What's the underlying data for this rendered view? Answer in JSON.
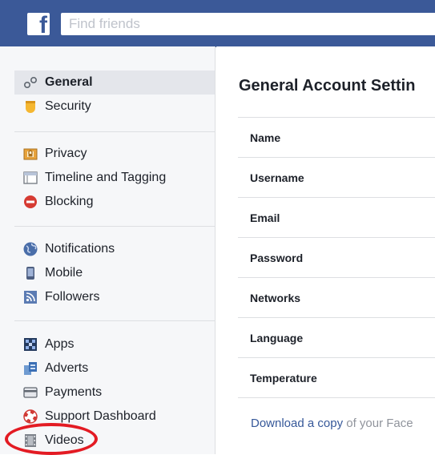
{
  "topbar": {
    "logo_letter": "f",
    "search_placeholder": "Find friends"
  },
  "sidebar": {
    "sections": [
      [
        {
          "label": "General",
          "icon": "gears-icon",
          "active": true
        },
        {
          "label": "Security",
          "icon": "badge-icon"
        }
      ],
      [
        {
          "label": "Privacy",
          "icon": "lock-icon"
        },
        {
          "label": "Timeline and Tagging",
          "icon": "timeline-icon"
        },
        {
          "label": "Blocking",
          "icon": "blocking-icon"
        }
      ],
      [
        {
          "label": "Notifications",
          "icon": "globe-icon"
        },
        {
          "label": "Mobile",
          "icon": "mobile-icon"
        },
        {
          "label": "Followers",
          "icon": "rss-icon"
        }
      ],
      [
        {
          "label": "Apps",
          "icon": "apps-icon"
        },
        {
          "label": "Adverts",
          "icon": "adverts-icon"
        },
        {
          "label": "Payments",
          "icon": "credit-card-icon"
        },
        {
          "label": "Support Dashboard",
          "icon": "lifebuoy-icon"
        },
        {
          "label": "Videos",
          "icon": "film-icon"
        }
      ]
    ]
  },
  "main": {
    "title": "General Account Settin",
    "settings": [
      "Name",
      "Username",
      "Email",
      "Password",
      "Networks",
      "Language",
      "Temperature"
    ],
    "download_link": "Download a copy",
    "download_suffix": " of your Face"
  }
}
